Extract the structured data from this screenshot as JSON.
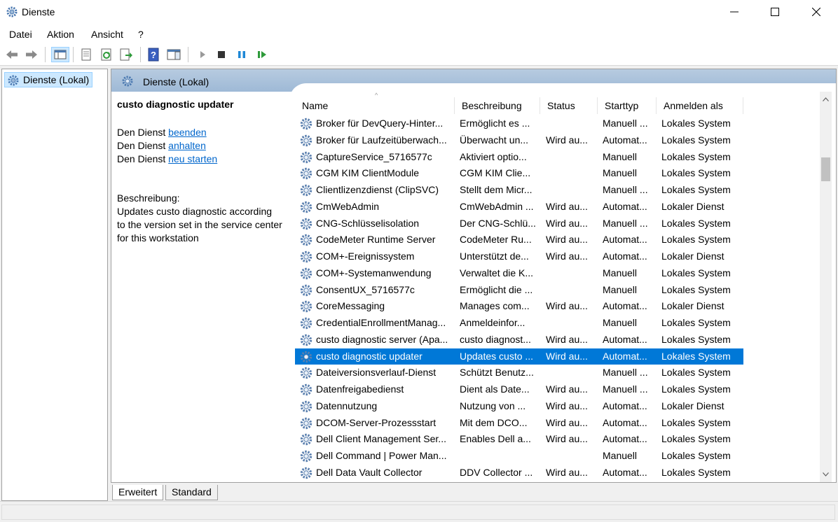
{
  "window": {
    "title": "Dienste",
    "icon": "gear-icon"
  },
  "menu": {
    "datei": "Datei",
    "aktion": "Aktion",
    "ansicht": "Ansicht",
    "hilfe": "?"
  },
  "toolbar": {
    "icons": [
      "back-arrow-icon",
      "forward-arrow-icon",
      "console-tree-icon",
      "properties-icon",
      "refresh-icon",
      "export-list-icon",
      "help-icon",
      "show-hide-action-pane-icon",
      "start-icon",
      "stop-icon",
      "pause-icon",
      "restart-icon"
    ]
  },
  "tree": {
    "root_label": "Dienste (Lokal)"
  },
  "header": {
    "label": "Dienste (Lokal)"
  },
  "details": {
    "service_name": "custo diagnostic updater",
    "prefix1": "Den Dienst ",
    "link_stop": "beenden",
    "prefix2": "Den Dienst ",
    "link_pause": "anhalten",
    "prefix3": "Den Dienst ",
    "link_restart": "neu starten",
    "desc_label": "Beschreibung:",
    "desc_line1": "Updates custo diagnostic according",
    "desc_line2": "to the version set in the service center",
    "desc_line3": "for this workstation"
  },
  "columns": {
    "name": "Name",
    "description": "Beschreibung",
    "status": "Status",
    "starttype": "Starttyp",
    "logon": "Anmelden als"
  },
  "rows": [
    {
      "name": "Broker für DevQuery-Hinter...",
      "desc": "Ermöglicht es ...",
      "status": "",
      "start": "Manuell ...",
      "logon": "Lokales System"
    },
    {
      "name": "Broker für Laufzeitüberwach...",
      "desc": "Überwacht un...",
      "status": "Wird au...",
      "start": "Automat...",
      "logon": "Lokales System"
    },
    {
      "name": "CaptureService_5716577c",
      "desc": "Aktiviert optio...",
      "status": "",
      "start": "Manuell",
      "logon": "Lokales System"
    },
    {
      "name": "CGM KIM ClientModule",
      "desc": "CGM KIM Clie...",
      "status": "",
      "start": "Manuell",
      "logon": "Lokales System"
    },
    {
      "name": "Clientlizenzdienst (ClipSVC)",
      "desc": "Stellt dem Micr...",
      "status": "",
      "start": "Manuell ...",
      "logon": "Lokales System"
    },
    {
      "name": "CmWebAdmin",
      "desc": "CmWebAdmin ...",
      "status": "Wird au...",
      "start": "Automat...",
      "logon": "Lokaler Dienst"
    },
    {
      "name": "CNG-Schlüsselisolation",
      "desc": "Der CNG-Schlü...",
      "status": "Wird au...",
      "start": "Manuell ...",
      "logon": "Lokales System"
    },
    {
      "name": "CodeMeter Runtime Server",
      "desc": "CodeMeter Ru...",
      "status": "Wird au...",
      "start": "Automat...",
      "logon": "Lokales System"
    },
    {
      "name": "COM+-Ereignissystem",
      "desc": "Unterstützt de...",
      "status": "Wird au...",
      "start": "Automat...",
      "logon": "Lokaler Dienst"
    },
    {
      "name": "COM+-Systemanwendung",
      "desc": "Verwaltet die K...",
      "status": "",
      "start": "Manuell",
      "logon": "Lokales System"
    },
    {
      "name": "ConsentUX_5716577c",
      "desc": "Ermöglicht die ...",
      "status": "",
      "start": "Manuell",
      "logon": "Lokales System"
    },
    {
      "name": "CoreMessaging",
      "desc": "Manages com...",
      "status": "Wird au...",
      "start": "Automat...",
      "logon": "Lokaler Dienst"
    },
    {
      "name": "CredentialEnrollmentManag...",
      "desc": "Anmeldeinfor...",
      "status": "",
      "start": "Manuell",
      "logon": "Lokales System"
    },
    {
      "name": "custo diagnostic server (Apa...",
      "desc": "custo diagnost...",
      "status": "Wird au...",
      "start": "Automat...",
      "logon": "Lokales System"
    },
    {
      "name": "custo diagnostic updater",
      "desc": "Updates custo ...",
      "status": "Wird au...",
      "start": "Automat...",
      "logon": "Lokales System",
      "selected": true
    },
    {
      "name": "Dateiversionsverlauf-Dienst",
      "desc": "Schützt Benutz...",
      "status": "",
      "start": "Manuell ...",
      "logon": "Lokales System"
    },
    {
      "name": "Datenfreigabedienst",
      "desc": "Dient als Date...",
      "status": "Wird au...",
      "start": "Manuell ...",
      "logon": "Lokales System"
    },
    {
      "name": "Datennutzung",
      "desc": "Nutzung von ...",
      "status": "Wird au...",
      "start": "Automat...",
      "logon": "Lokaler Dienst"
    },
    {
      "name": "DCOM-Server-Prozessstart",
      "desc": "Mit dem DCO...",
      "status": "Wird au...",
      "start": "Automat...",
      "logon": "Lokales System"
    },
    {
      "name": "Dell Client Management Ser...",
      "desc": "Enables Dell a...",
      "status": "Wird au...",
      "start": "Automat...",
      "logon": "Lokales System"
    },
    {
      "name": "Dell Command | Power Man...",
      "desc": "",
      "status": "",
      "start": "Manuell",
      "logon": "Lokales System"
    },
    {
      "name": "Dell Data Vault Collector",
      "desc": "DDV Collector ...",
      "status": "Wird au...",
      "start": "Automat...",
      "logon": "Lokales System"
    }
  ],
  "tabs": {
    "extended": "Erweitert",
    "standard": "Standard"
  },
  "colors": {
    "selection": "#0078d7",
    "link": "#0066cc",
    "header_gradient": "#b7cbe0"
  }
}
